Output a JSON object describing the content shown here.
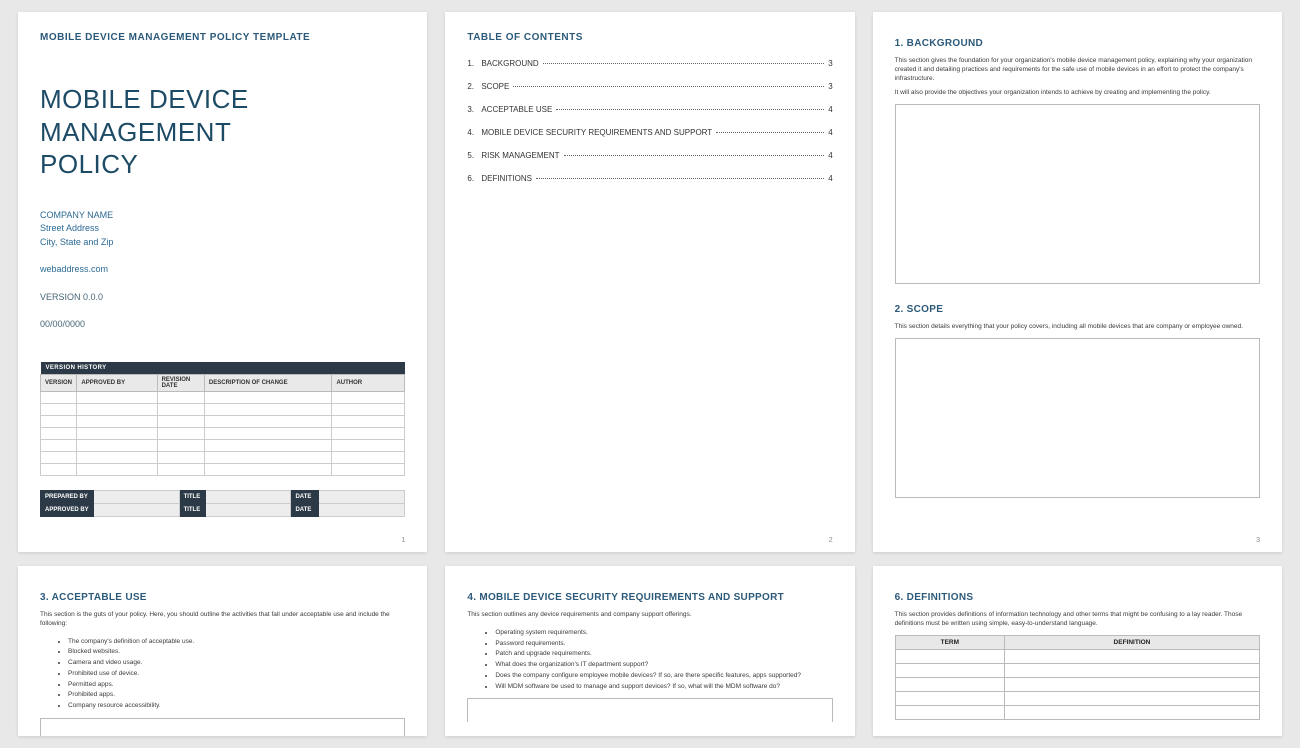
{
  "page1": {
    "template_label": "MOBILE DEVICE MANAGEMENT POLICY TEMPLATE",
    "title_l1": "MOBILE DEVICE",
    "title_l2": "MANAGEMENT",
    "title_l3": "POLICY",
    "company_name": "COMPANY NAME",
    "street": "Street Address",
    "citystatezip": "City, State and Zip",
    "webaddress": "webaddress.com",
    "version": "VERSION 0.0.0",
    "date": "00/00/0000",
    "vhist_banner": "VERSION HISTORY",
    "vhist_cols": [
      "VERSION",
      "APPROVED BY",
      "REVISION DATE",
      "DESCRIPTION OF CHANGE",
      "AUTHOR"
    ],
    "sig_labels": {
      "prepared": "PREPARED BY",
      "approved": "APPROVED BY",
      "title": "TITLE",
      "date": "DATE"
    },
    "page_num": "1"
  },
  "page2": {
    "title": "TABLE OF CONTENTS",
    "items": [
      {
        "n": "1.",
        "label": "BACKGROUND",
        "pg": "3"
      },
      {
        "n": "2.",
        "label": "SCOPE",
        "pg": "3"
      },
      {
        "n": "3.",
        "label": "ACCEPTABLE USE",
        "pg": "4"
      },
      {
        "n": "4.",
        "label": "MOBILE DEVICE SECURITY REQUIREMENTS AND SUPPORT",
        "pg": "4"
      },
      {
        "n": "5.",
        "label": "RISK MANAGEMENT",
        "pg": "4"
      },
      {
        "n": "6.",
        "label": "DEFINITIONS",
        "pg": "4"
      }
    ],
    "page_num": "2"
  },
  "page3": {
    "sec1_heading": "1.  BACKGROUND",
    "sec1_desc1": "This section gives the foundation for your organization's mobile device management policy, explaining why your organization created it and detailing practices and requirements for the safe use of mobile devices in an effort to protect the company's infrastructure.",
    "sec1_desc2": "It will also provide the objectives your organization intends to achieve by creating and implementing the policy.",
    "sec2_heading": "2.  SCOPE",
    "sec2_desc": "This section details everything that your policy covers, including all mobile devices that are company or employee owned.",
    "page_num": "3"
  },
  "page4": {
    "heading": "3.  ACCEPTABLE USE",
    "intro": "This section is the guts of your policy. Here, you should outline the activities that fall under acceptable use and include the following:",
    "bullets": [
      "The company's definition of acceptable use.",
      "Blocked websites.",
      "Camera and video usage.",
      "Prohibited use of device.",
      "Permitted apps.",
      "Prohibited apps.",
      "Company resource accessibility."
    ]
  },
  "page5": {
    "heading": "4.  MOBILE DEVICE SECURITY REQUIREMENTS AND SUPPORT",
    "intro": "This section outlines any device requirements and company support offerings.",
    "bullets": [
      "Operating system requirements.",
      "Password requirements.",
      "Patch and upgrade requirements.",
      "What does the organization's IT department support?",
      "Does the company configure employee mobile devices? If so, are there specific features, apps supported?",
      "Will MDM software be used to manage and support devices? If so, what will the MDM software do?"
    ]
  },
  "page6": {
    "heading": "6.  DEFINITIONS",
    "intro": "This section provides definitions of information technology and other terms that might be confusing to a lay reader. Those definitions must be written using simple, easy-to-understand language.",
    "cols": [
      "TERM",
      "DEFINITION"
    ]
  }
}
